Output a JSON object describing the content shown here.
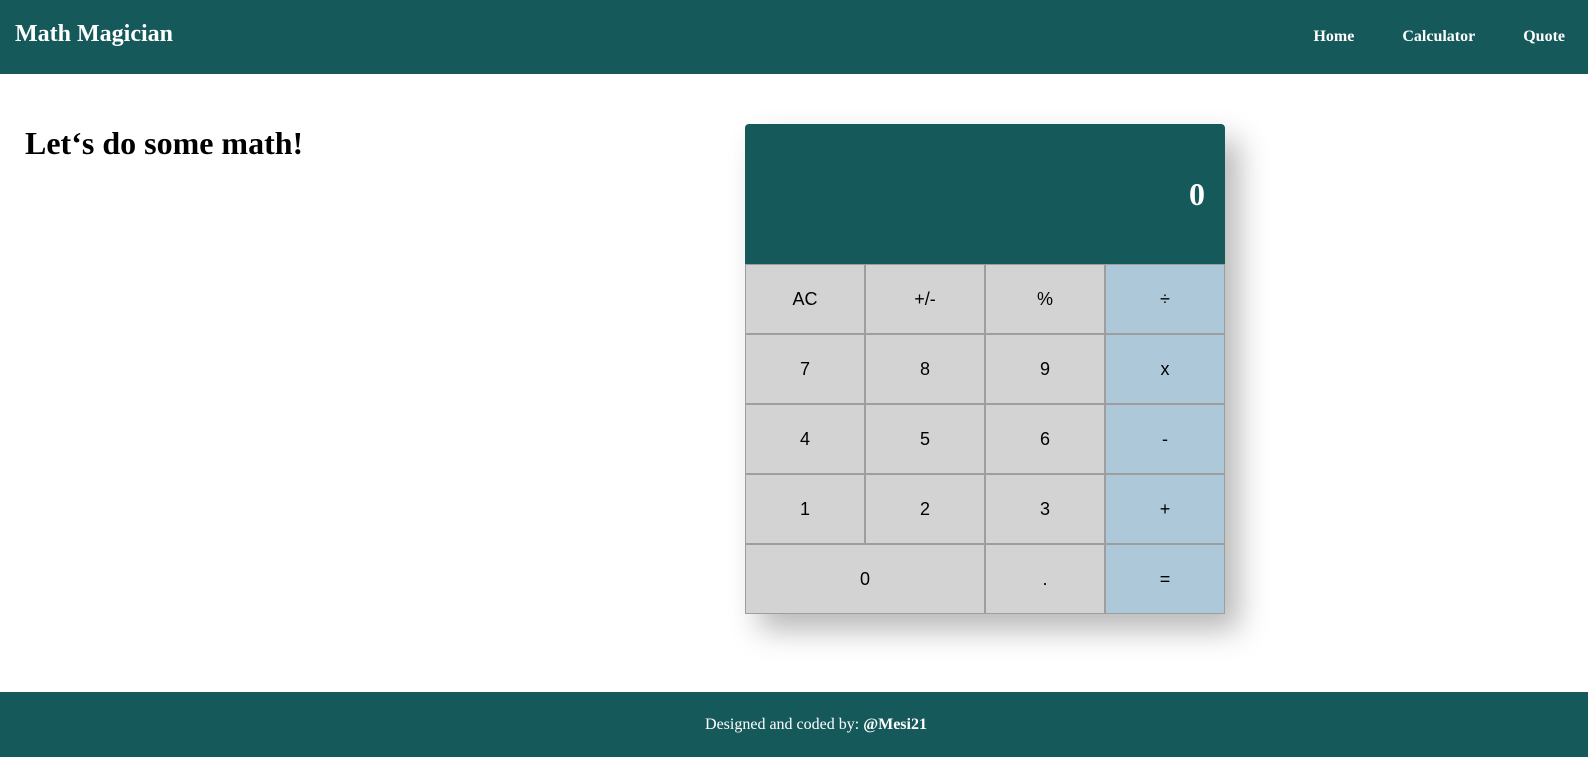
{
  "header": {
    "brand": "Math Magician",
    "nav": [
      {
        "label": "Home"
      },
      {
        "label": "Calculator"
      },
      {
        "label": "Quote"
      }
    ]
  },
  "main": {
    "heading": "Let‘s do some math!"
  },
  "calculator": {
    "display": "0",
    "keys": [
      {
        "label": "AC",
        "type": "func"
      },
      {
        "label": "+/-",
        "type": "func"
      },
      {
        "label": "%",
        "type": "func"
      },
      {
        "label": "÷",
        "type": "op"
      },
      {
        "label": "7",
        "type": "num"
      },
      {
        "label": "8",
        "type": "num"
      },
      {
        "label": "9",
        "type": "num"
      },
      {
        "label": "x",
        "type": "op"
      },
      {
        "label": "4",
        "type": "num"
      },
      {
        "label": "5",
        "type": "num"
      },
      {
        "label": "6",
        "type": "num"
      },
      {
        "label": "-",
        "type": "op"
      },
      {
        "label": "1",
        "type": "num"
      },
      {
        "label": "2",
        "type": "num"
      },
      {
        "label": "3",
        "type": "num"
      },
      {
        "label": "+",
        "type": "op"
      },
      {
        "label": "0",
        "type": "num"
      },
      {
        "label": ".",
        "type": "num"
      },
      {
        "label": "=",
        "type": "op"
      }
    ]
  },
  "footer": {
    "text": "Designed and coded by:",
    "handle": "@Mesi21"
  },
  "colors": {
    "primary": "#15595a",
    "key": "#d3d3d3",
    "operator_key": "#adc8d8"
  }
}
